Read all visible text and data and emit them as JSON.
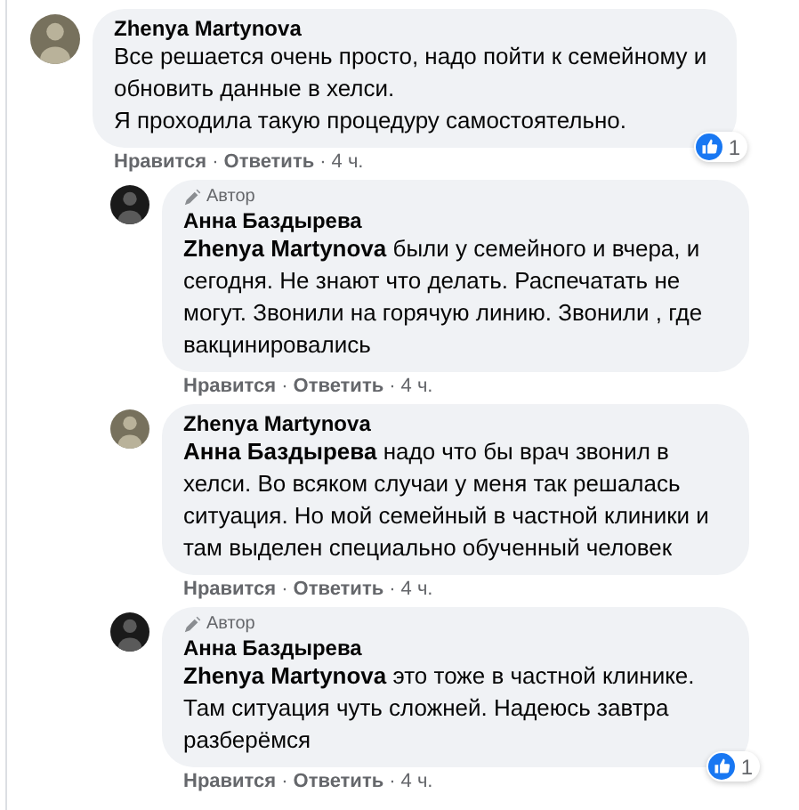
{
  "action_separator": "·",
  "comments": [
    {
      "author": "Zhenya Martynova",
      "text": "Все решается очень просто, надо пойти к семейному и обновить данные в хелси.\nЯ проходила такую процедуру самостоятельно.",
      "reactions": "1",
      "actions": [
        "Нравится",
        "Ответить",
        "4 ч."
      ],
      "children": [
        {
          "author": "Анна Баздырева",
          "author_badge": "Автор",
          "text": "**Zhenya Martynova** были у семейного и вчера, и сегодня. Не знают что делать. Распечатать не могут. Звонили на горячую линию. Звонили , где вакцинировались",
          "actions": [
            "Нравится",
            "Ответить",
            "4 ч."
          ]
        },
        {
          "author": "Zhenya Martynova",
          "text": "**Анна Баздырева** надо что бы врач звонил в хелси. Во всяком случаи у меня так решалась ситуация. Но мой семейный в частной клиники и там выделен специально обученный человек",
          "actions": [
            "Нравится",
            "Ответить",
            "4 ч."
          ]
        },
        {
          "author": "Анна Баздырева",
          "author_badge": "Автор",
          "text": "**Zhenya Martynova** это тоже в частной клинике. Там ситуация чуть сложней. Надеюсь завтра разберёмся",
          "reactions": "1",
          "actions": [
            "Нравится",
            "Ответить",
            "4 ч."
          ]
        }
      ]
    }
  ]
}
